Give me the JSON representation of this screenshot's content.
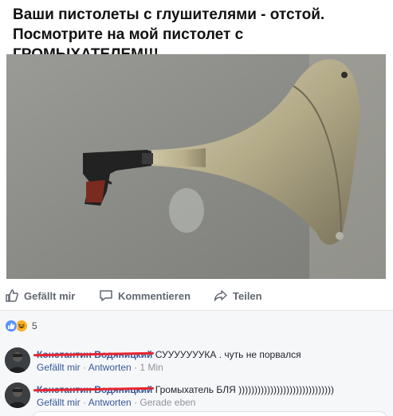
{
  "meme": {
    "caption_line1": "Ваши пистолеты с глушителями - отстой.",
    "caption_line2": "Посмотрите на мой пистолет с ГРОМЫХАТЕЛЕМ!!!"
  },
  "actions": {
    "like_label": "Gefällt mir",
    "comment_label": "Kommentieren",
    "share_label": "Teilen"
  },
  "reactions": {
    "icons": [
      "like-icon",
      "haha-icon"
    ],
    "count": "5"
  },
  "comments": [
    {
      "author": "Константин Водяницкий",
      "text": "СУУУУУУУКА . чуть не порвался",
      "like": "Gefällt mir",
      "reply": "Antworten",
      "time": "1 Min"
    },
    {
      "author": "Константин Водяницкий",
      "text": "Громыхатель БЛЯ ))))))))))))))))))))))))))))))",
      "like": "Gefällt mir",
      "reply": "Antworten",
      "time": "Gerade eben"
    }
  ],
  "colors": {
    "link": "#365899",
    "muted": "#90949c",
    "action_text": "#616770",
    "redaction": "#e8252e"
  }
}
